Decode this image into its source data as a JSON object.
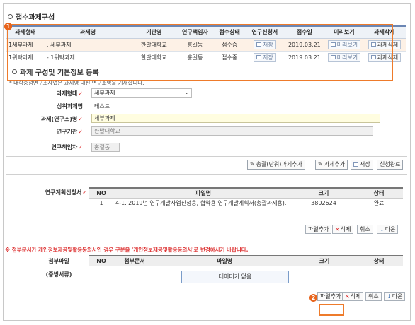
{
  "section1": {
    "title": "접수과제구성"
  },
  "task_table": {
    "headers": [
      "과제형태",
      "과제명",
      "기관명",
      "연구책임자",
      "접수상태",
      "연구신청서",
      "접수일",
      "미리보기",
      "과제삭제"
    ],
    "rows": [
      {
        "type": "1세부과제",
        "name": ", 세부과제",
        "org": "한발대학교",
        "pi": "홍길동",
        "status": "접수중",
        "apply": "저장",
        "date": "2019.03.21",
        "preview": "미리보기",
        "delete": "과제삭제"
      },
      {
        "type": "1위탁과제",
        "name": "- 1위탁과제",
        "org": "한발대학교",
        "pi": "홍길동",
        "status": "접수중",
        "apply": "저장",
        "date": "2019.03.21",
        "preview": "미리보기",
        "delete": "과제삭제"
      }
    ]
  },
  "section2": {
    "title": "과제 구성및 기본정보 등록",
    "note": "* 대학중점연구소사업은 과제명 대신 연구소명을 기재합니다."
  },
  "form": {
    "task_type": {
      "label": "과제형태",
      "value": "세부과제"
    },
    "parent_task": {
      "label": "상위과제명",
      "value": "테스트"
    },
    "task_name": {
      "label": "과제(연구소)명",
      "value": "세부과제"
    },
    "institution": {
      "label": "연구기관",
      "value": "한발대학교"
    },
    "pi": {
      "label": "연구책임자",
      "value": "홍길동"
    }
  },
  "actions": {
    "bulk_add": "총괄(단위)과제추가",
    "add": "과제추가",
    "save": "저장",
    "submit": "신청완료"
  },
  "plan": {
    "label": "연구계획신청서",
    "headers": [
      "NO",
      "파일명",
      "크기",
      "상태"
    ],
    "rows": [
      {
        "no": "1",
        "file": "4-1. 2019년 연구개발사업신청용, 협약용 연구개발계획서(총괄과제용).",
        "size": "3802624",
        "status": "완료"
      }
    ],
    "buttons": {
      "add": "파일추가",
      "delete": "삭제",
      "cancel": "취소",
      "down": "다운"
    }
  },
  "warning": "※ 첨부문서가 개인정보제공및활용동의서인 경우 구분을 '개인정보제공및활용동의서'로 변경하시기 바랍니다.",
  "attach": {
    "label": "첨부파일",
    "sublabel": "(증빙서류)",
    "headers": [
      "NO",
      "첨부문서",
      "파일명",
      "크기",
      "상태"
    ],
    "empty": "데이터가 없음",
    "buttons": {
      "add": "파일추가",
      "delete": "삭제",
      "cancel": "취소",
      "down": "다운"
    }
  },
  "badges": {
    "one": "1",
    "two": "2"
  },
  "colors": {
    "highlight": "#ee7b2b",
    "header_blue": "#6b86b4",
    "required": "#d22222"
  }
}
